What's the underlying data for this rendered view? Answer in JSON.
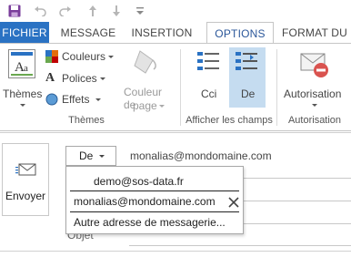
{
  "quick_access": {
    "icons": [
      "save-icon",
      "undo-icon",
      "redo-icon",
      "move-up-icon",
      "move-down-icon",
      "customize-icon"
    ]
  },
  "tabs": [
    {
      "label": "FICHIER"
    },
    {
      "label": "MESSAGE"
    },
    {
      "label": "INSERTION"
    },
    {
      "label": "OPTIONS"
    },
    {
      "label": "FORMAT DU"
    }
  ],
  "ribbon": {
    "themes_group": {
      "label": "Thèmes",
      "themes_button": "Thèmes",
      "colors_button": "Couleurs",
      "fonts_button": "Polices",
      "effects_button": "Effets",
      "page_color_line1": "Couleur de",
      "page_color_line2": "page"
    },
    "fields_group": {
      "label": "Afficher les champs",
      "bcc_button": "Cci",
      "from_button": "De"
    },
    "permission_group": {
      "label": "Autorisation",
      "permission_button": "Autorisation"
    },
    "accent_color": "#2b579a",
    "selected_button_bg": "#c5dcf0"
  },
  "compose": {
    "send_button": "Envoyer",
    "from_button": "De",
    "from_value": "monalias@mondomaine.com",
    "subject_label": "Objet"
  },
  "dropdown": {
    "items": [
      {
        "label": "demo@sos-data.fr"
      },
      {
        "label": "monalias@mondomaine.com"
      },
      {
        "label": "Autre adresse de messagerie..."
      }
    ]
  }
}
